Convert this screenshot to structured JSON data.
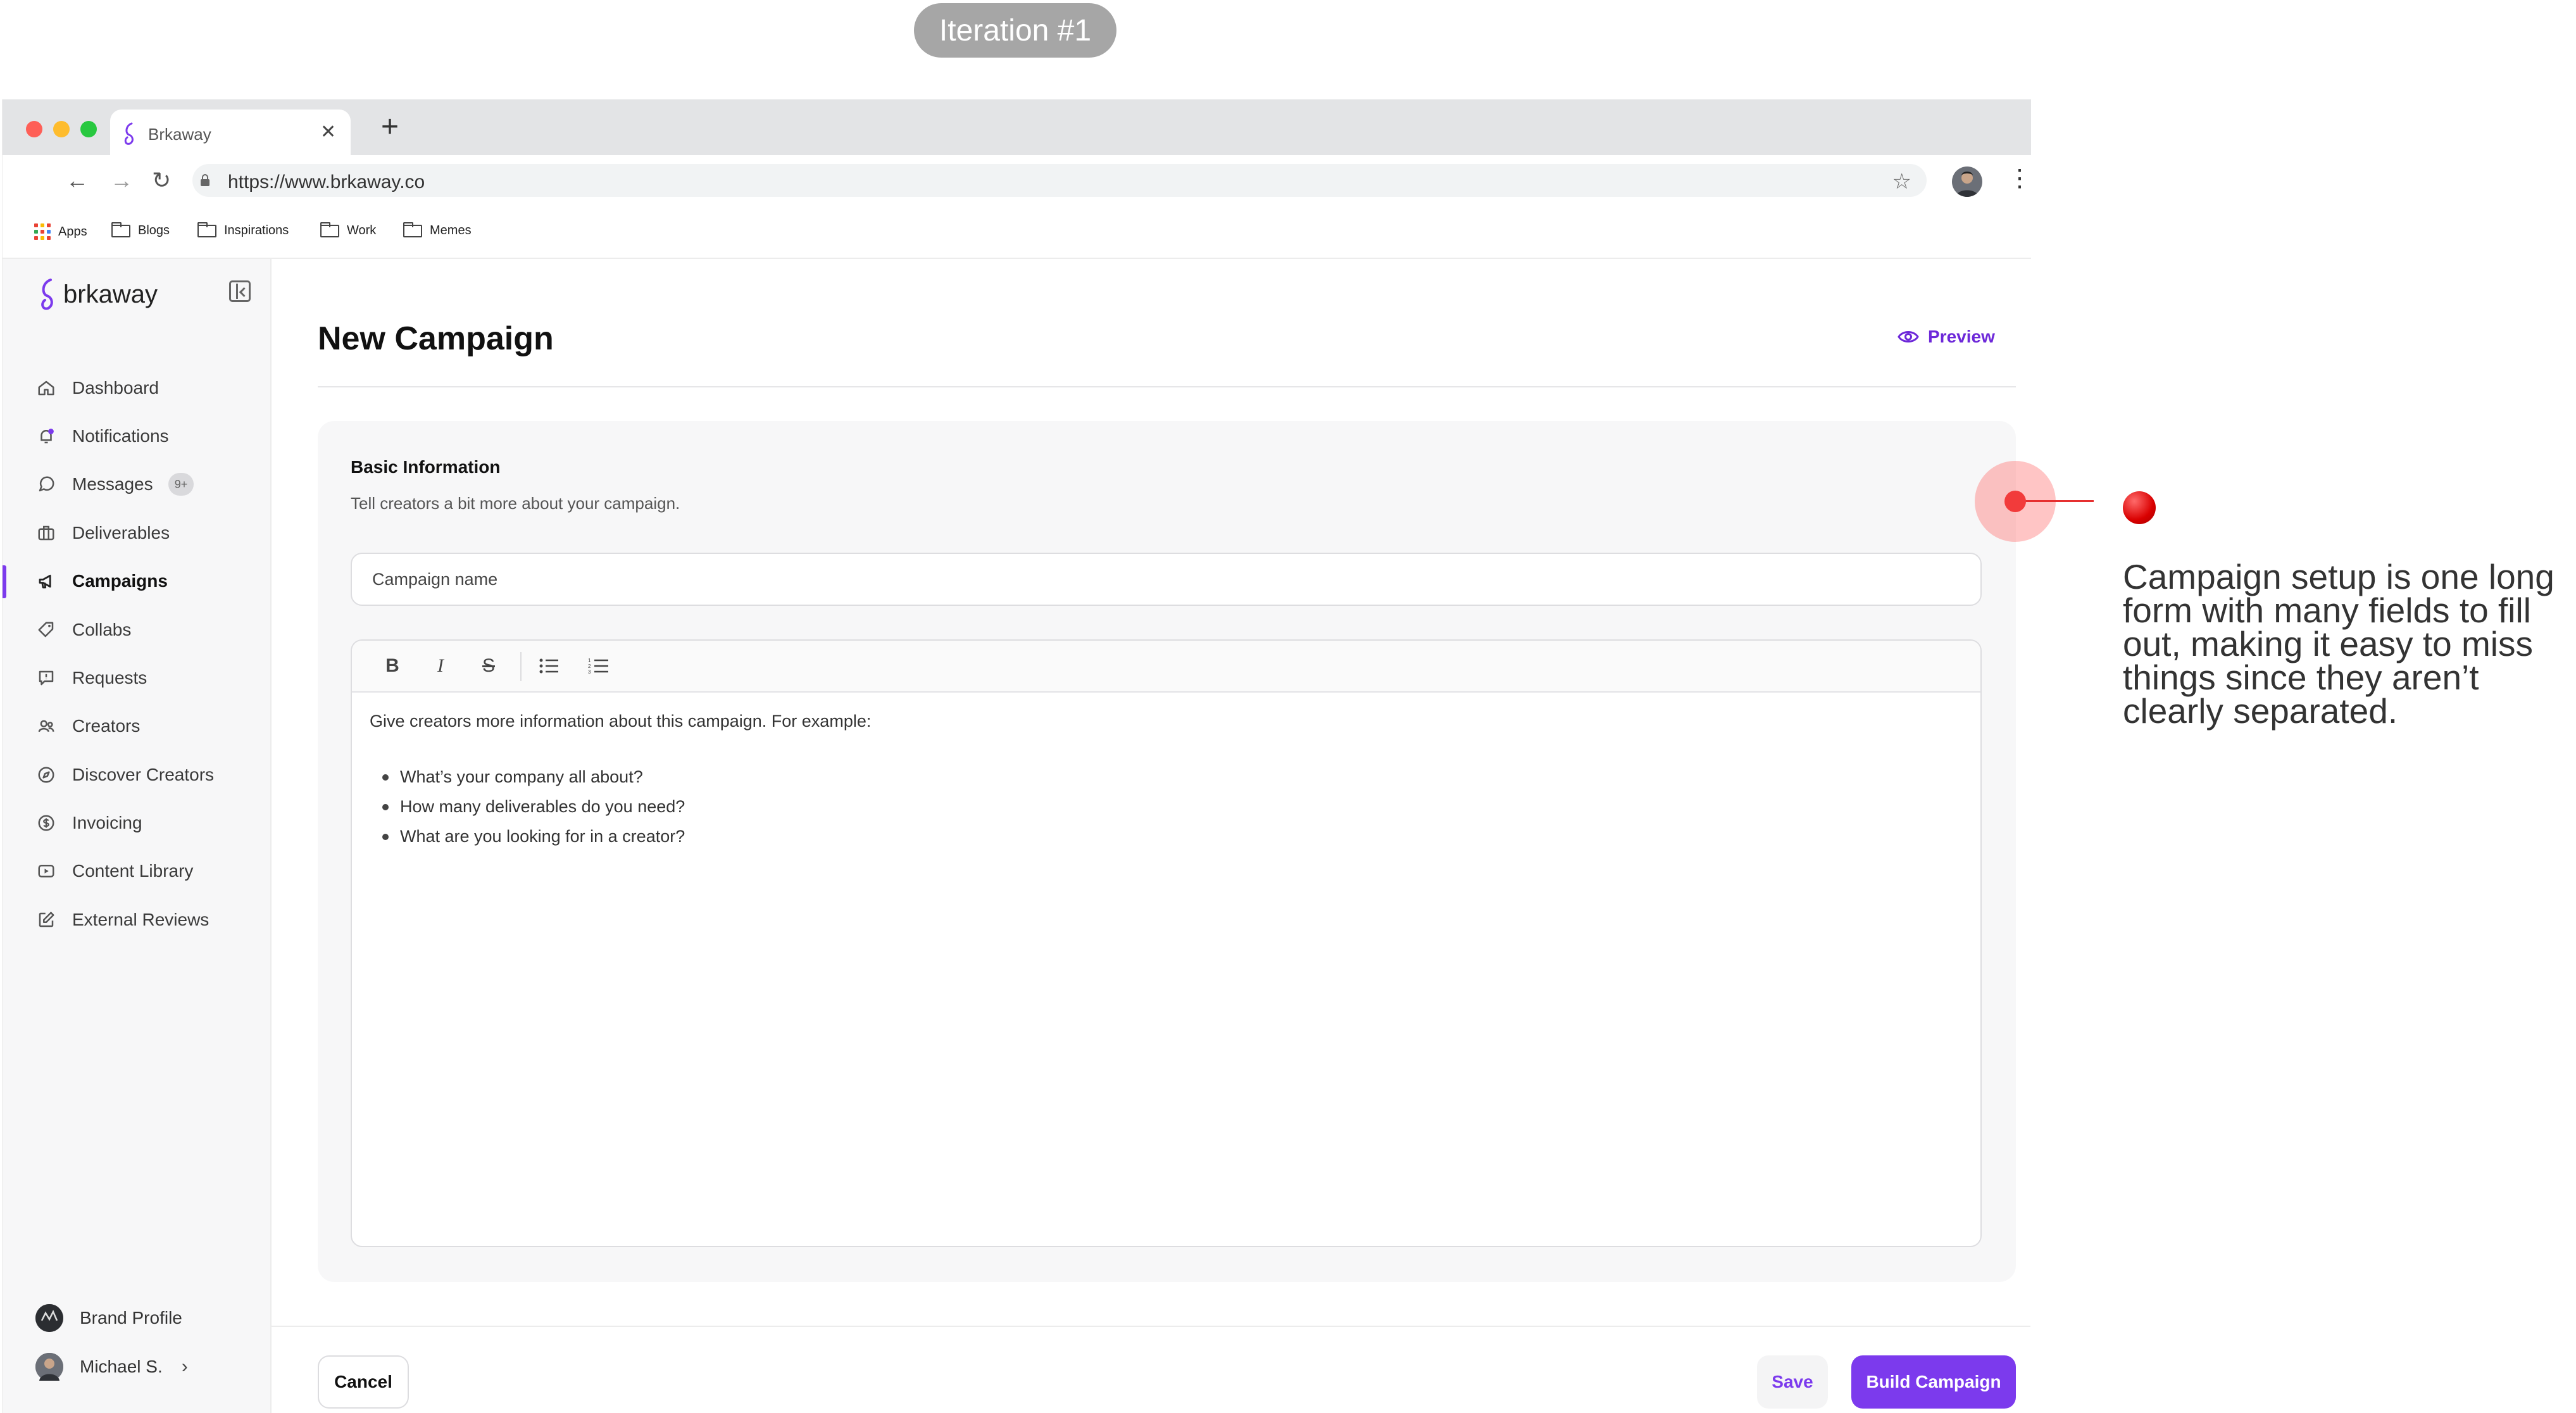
{
  "iteration_label": "Iteration #1",
  "browser": {
    "tab_title": "Brkaway",
    "url": "https://www.brkaway.co",
    "bookmarks": [
      "Apps",
      "Blogs",
      "Inspirations",
      "Work",
      "Memes"
    ]
  },
  "sidebar": {
    "brand_name": "brkaway",
    "items": [
      {
        "label": "Dashboard",
        "icon": "home-icon"
      },
      {
        "label": "Notifications",
        "icon": "bell-icon"
      },
      {
        "label": "Messages",
        "icon": "chat-icon",
        "badge": "9+"
      },
      {
        "label": "Deliverables",
        "icon": "briefcase-icon"
      },
      {
        "label": "Campaigns",
        "icon": "megaphone-icon",
        "active": true
      },
      {
        "label": "Collabs",
        "icon": "tag-icon"
      },
      {
        "label": "Requests",
        "icon": "request-icon"
      },
      {
        "label": "Creators",
        "icon": "users-icon"
      },
      {
        "label": "Discover Creators",
        "icon": "compass-icon"
      },
      {
        "label": "Invoicing",
        "icon": "dollar-icon"
      },
      {
        "label": "Content Library",
        "icon": "video-icon"
      },
      {
        "label": "External Reviews",
        "icon": "edit-icon"
      }
    ],
    "footer": {
      "brand_profile": "Brand Profile",
      "user_name": "Michael S."
    }
  },
  "main": {
    "title": "New Campaign",
    "preview_label": "Preview",
    "section": {
      "title": "Basic Information",
      "description": "Tell creators a bit more about your campaign.",
      "name_placeholder": "Campaign name",
      "editor_intro": "Give creators more information about this campaign. For example:",
      "editor_bullets": [
        "What’s your company all about?",
        "How many deliverables do you need?",
        "What are you looking for in a creator?"
      ]
    },
    "actions": {
      "cancel": "Cancel",
      "save": "Save",
      "build": "Build Campaign"
    }
  },
  "annotation": {
    "note": "Campaign setup is one long form with many fields to fill out, making it easy to miss things since they aren’t clearly separated."
  },
  "colors": {
    "accent": "#7c3aed",
    "annotation_red": "#f23b3b"
  }
}
